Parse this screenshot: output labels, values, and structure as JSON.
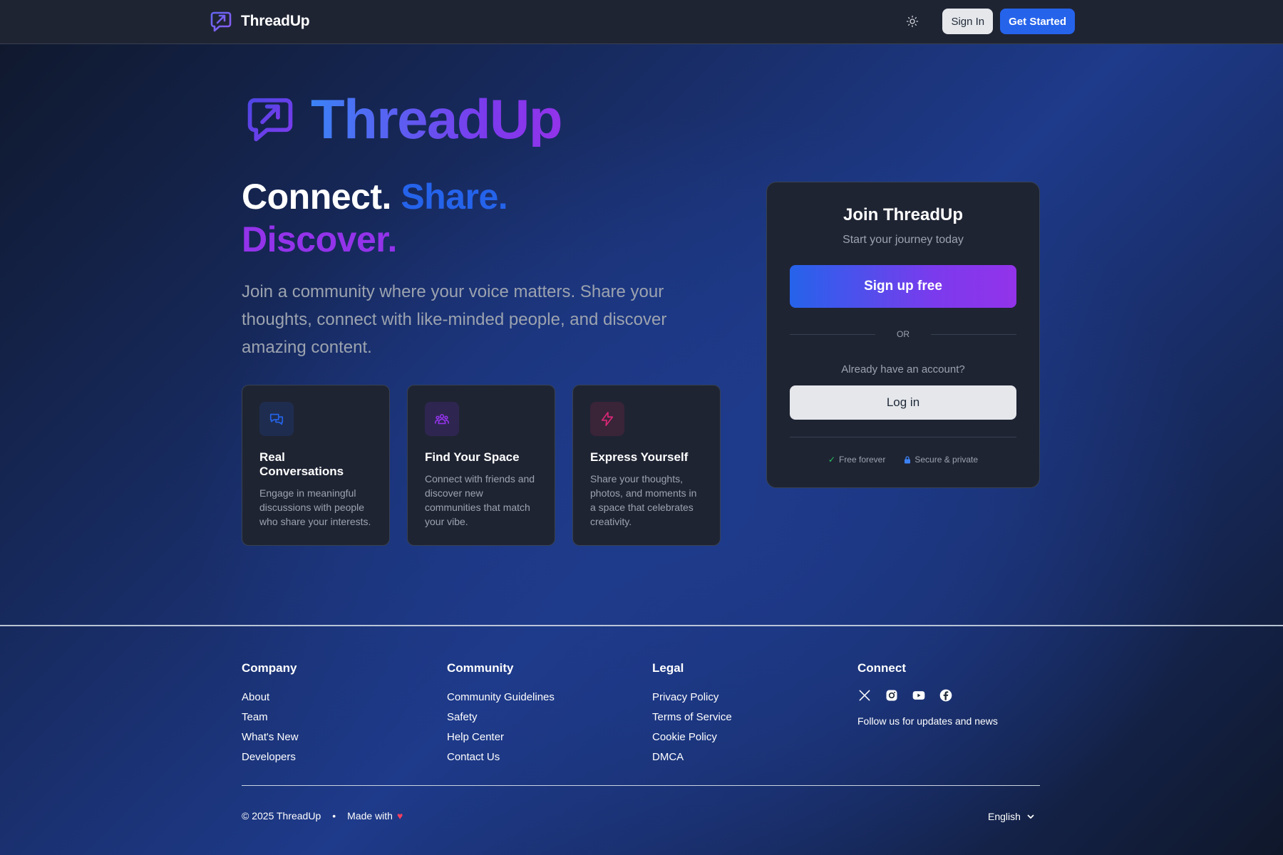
{
  "nav": {
    "brand": "ThreadUp",
    "logo_icon": "arrow-bubble-logo-icon",
    "theme_icon": "sun-icon",
    "sign_in": "Sign In",
    "get_started": "Get Started"
  },
  "hero": {
    "logo_text": "ThreadUp",
    "headline": {
      "word1": "Connect.",
      "word2": "Share.",
      "word3": "Discover."
    },
    "description": "Join a community where your voice matters. Share your thoughts, connect with like-minded people, and discover amazing content.",
    "features": [
      {
        "icon": "chat-bubbles-icon",
        "title": "Real Conversations",
        "text": "Engage in meaningful discussions with people who share your interests."
      },
      {
        "icon": "users-group-icon",
        "title": "Find Your Space",
        "text": "Connect with friends and discover new communities that match your vibe."
      },
      {
        "icon": "lightning-icon",
        "title": "Express Yourself",
        "text": "Share your thoughts, photos, and moments in a space that celebrates creativity."
      }
    ]
  },
  "join_card": {
    "title": "Join ThreadUp",
    "subtitle": "Start your journey today",
    "signup_button": "Sign up free",
    "or_text": "OR",
    "already_text": "Already have an account?",
    "login_button": "Log in",
    "assurance_free": "Free forever",
    "assurance_secure": "Secure & private"
  },
  "footer": {
    "columns": [
      {
        "title": "Company",
        "links": [
          "About",
          "Team",
          "What's New",
          "Developers"
        ]
      },
      {
        "title": "Community",
        "links": [
          "Community Guidelines",
          "Safety",
          "Help Center",
          "Contact Us"
        ]
      },
      {
        "title": "Legal",
        "links": [
          "Privacy Policy",
          "Terms of Service",
          "Cookie Policy",
          "DMCA"
        ]
      }
    ],
    "connect": {
      "title": "Connect",
      "social_icons": [
        "x-icon",
        "instagram-icon",
        "youtube-icon",
        "facebook-icon"
      ],
      "follow_text": "Follow us for updates and news"
    },
    "copyright": "© 2025 ThreadUp",
    "bullet": "•",
    "made_with": "Made with",
    "heart": "♥",
    "language": "English"
  },
  "colors": {
    "accent_blue": "#2563eb",
    "accent_purple": "#9333ea",
    "accent_pink": "#db2777",
    "card_bg": "#1f2433"
  }
}
